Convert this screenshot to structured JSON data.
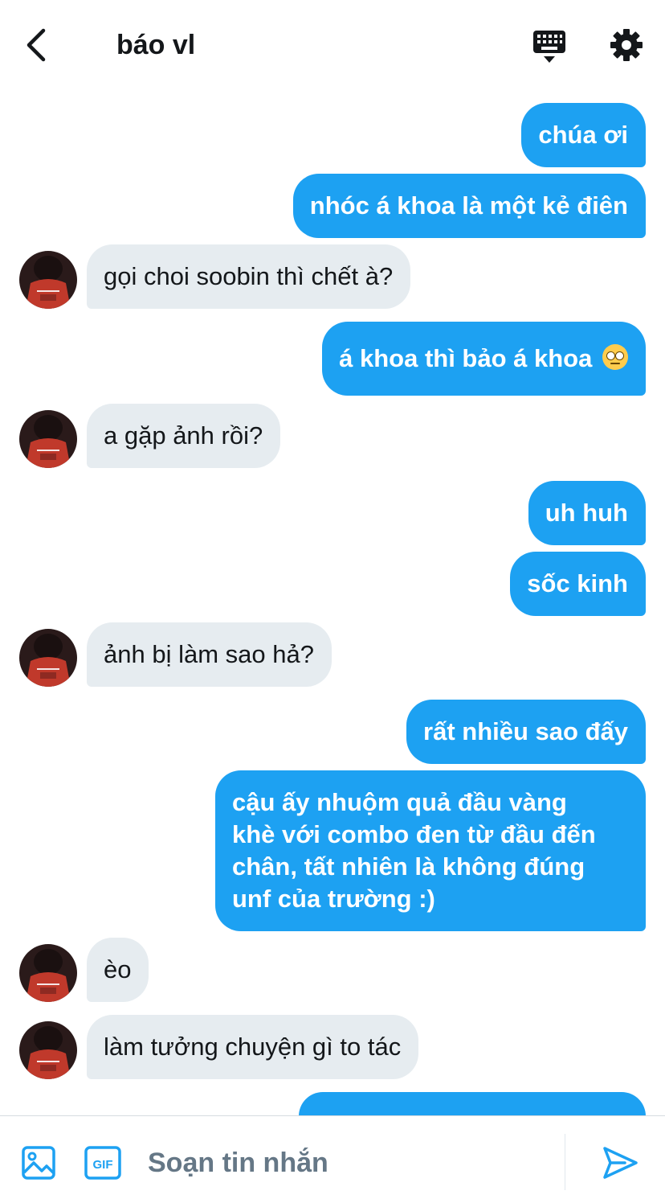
{
  "header": {
    "title": "báo vl",
    "back_icon": "chevron-left-icon",
    "keyboard_icon": "keyboard-icon",
    "settings_icon": "gear-icon"
  },
  "messages": [
    {
      "side": "sent",
      "text": "chúa ơi"
    },
    {
      "side": "sent",
      "text": "nhóc á khoa là một kẻ điên"
    },
    {
      "side": "received",
      "text": "gọi choi soobin thì chết à?"
    },
    {
      "side": "sent",
      "text": "á khoa thì bảo á khoa",
      "emoji": "rolling-eyes-emoji"
    },
    {
      "side": "received",
      "text": "a gặp ảnh rồi?"
    },
    {
      "side": "sent",
      "text": "uh huh"
    },
    {
      "side": "sent",
      "text": "sốc kinh"
    },
    {
      "side": "received",
      "text": "ảnh bị làm sao hả?"
    },
    {
      "side": "sent",
      "text": "rất nhiều sao đấy"
    },
    {
      "side": "sent",
      "lines": [
        "cậu ấy nhuộm quả đầu vàng",
        "khè với combo đen từ đầu đến",
        "chân, tất nhiên là không đúng",
        "unf của trường :)"
      ]
    },
    {
      "side": "received",
      "text": "èo"
    },
    {
      "side": "received",
      "text": "làm tưởng chuyện gì to tác"
    }
  ],
  "composer": {
    "placeholder": "Soạn tin nhắn",
    "media_icon": "image-icon",
    "gif_icon": "gif-icon",
    "gif_label": "GIF",
    "send_icon": "send-icon"
  },
  "colors": {
    "accent": "#1da1f2",
    "received_bubble": "#e6ecf0",
    "text": "#14171a",
    "placeholder": "#657786"
  }
}
